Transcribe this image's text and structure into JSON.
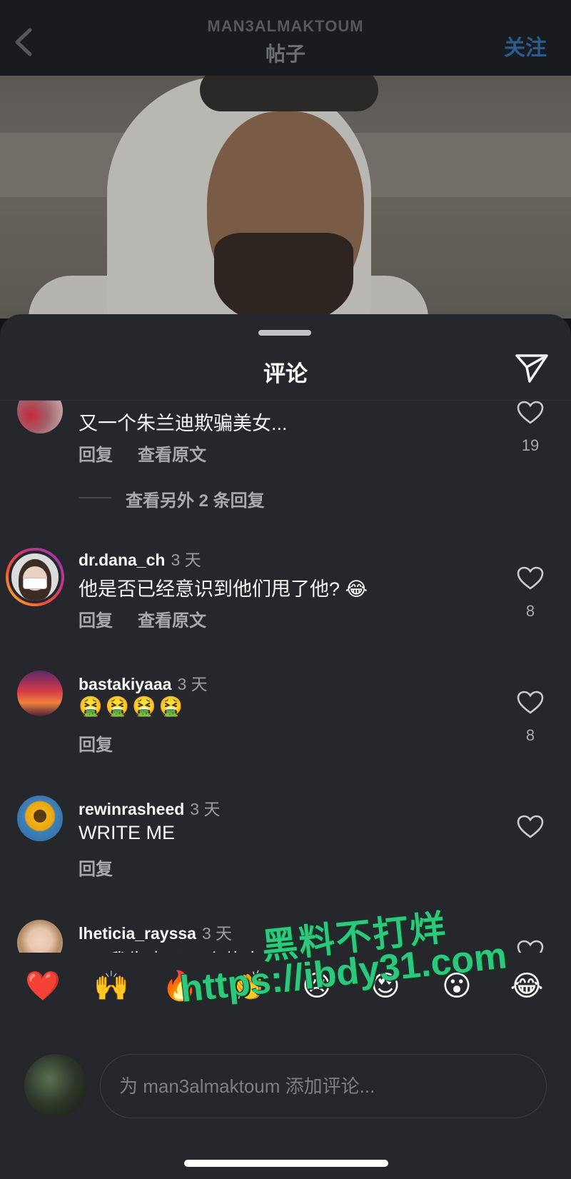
{
  "header": {
    "username": "MAN3ALMAKTOUM",
    "title": "帖子",
    "follow_label": "关注"
  },
  "sheet": {
    "title": "评论"
  },
  "comments": [
    {
      "username": "",
      "time": "",
      "text": "又一个朱兰迪欺骗美女...",
      "reply_label": "回复",
      "translate_label": "查看原文",
      "likes": "19",
      "more_replies": "查看另外 2 条回复"
    },
    {
      "username": "dr.dana_ch",
      "time": "3 天",
      "text": "他是否已经意识到他们甩了他? 😂",
      "reply_label": "回复",
      "translate_label": "查看原文",
      "likes": "8"
    },
    {
      "username": "bastakiyaaa",
      "time": "3 天",
      "text": "🤮🤮🤮🤮",
      "reply_label": "回复",
      "likes": "8"
    },
    {
      "username": "rewinrasheed",
      "time": "3 天",
      "text": "WRITE ME",
      "reply_label": "回复"
    },
    {
      "username": "lheticia_rayssa",
      "time": "3 天",
      "text": "🇧🇷 我失去了一个伟大"
    }
  ],
  "emoji_bar": [
    "❤️",
    "🙌",
    "🔥",
    "👏",
    "😢",
    "😍",
    "😮",
    "😂"
  ],
  "composer": {
    "placeholder": "为 man3almaktoum 添加评论..."
  },
  "watermark": {
    "line1": "黑料不打烊",
    "line2": "https://ibdy31.com"
  },
  "colors": {
    "background": "#25272c",
    "follow_accent": "#2a5d8f",
    "watermark_green": "#2ec77e"
  }
}
